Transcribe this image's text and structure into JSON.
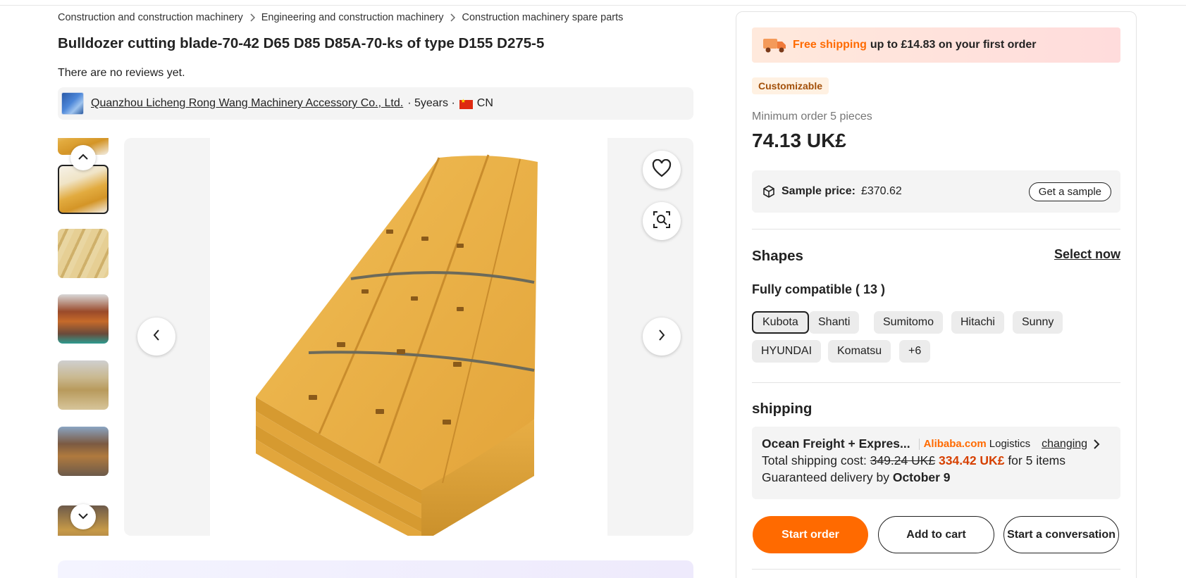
{
  "breadcrumb": [
    "Construction and construction machinery",
    "Engineering and construction machinery",
    "Construction machinery spare parts"
  ],
  "product": {
    "title": "Bulldozer cutting blade-70-42 D65 D85 D85A-70-ks of type D155 D275-5",
    "reviews": "There are no reviews yet."
  },
  "supplier": {
    "name": "Quanzhou Licheng Rong Wang Machinery Accessory Co., Ltd.",
    "years": "· 5years ·",
    "country": "CN"
  },
  "gallery": {
    "thumbnail_count": 7,
    "active_thumbnail": 1
  },
  "banner": {
    "highlight": "Free shipping",
    "text": "up to £14.83 on your first order"
  },
  "badge": "Customizable",
  "pricing": {
    "min_order": "Minimum order 5 pieces",
    "price": "74.13 UK£",
    "sample_label": "Sample price:",
    "sample_value": "£370.62",
    "sample_button": "Get a sample"
  },
  "shapes": {
    "title": "Shapes",
    "select_now": "Select now",
    "compat_label": "Fully compatible ( 13 )",
    "options": [
      "Kubota",
      "Shanti",
      "Sumitomo",
      "Hitachi",
      "Sunny",
      "HYUNDAI",
      "Komatsu",
      "+6"
    ],
    "selected": "Kubota"
  },
  "shipping": {
    "title": "shipping",
    "method": "Ocean Freight + Expres...",
    "carrier_brand": "Alibaba.com",
    "carrier_suffix": "Logistics",
    "change": "changing",
    "total_label": "Total shipping cost:",
    "old_price": "349.24 UK£",
    "new_price": "334.42 UK£",
    "for_items": "for 5 items",
    "guarantee_label": "Guaranteed delivery by",
    "guarantee_date": "October 9"
  },
  "actions": {
    "start_order": "Start order",
    "add_to_cart": "Add to cart",
    "conversation": "Start a conversation"
  },
  "colors": {
    "accent": "#ff6a00",
    "discount_price": "#d64000",
    "badge_text": "#a3500a"
  }
}
